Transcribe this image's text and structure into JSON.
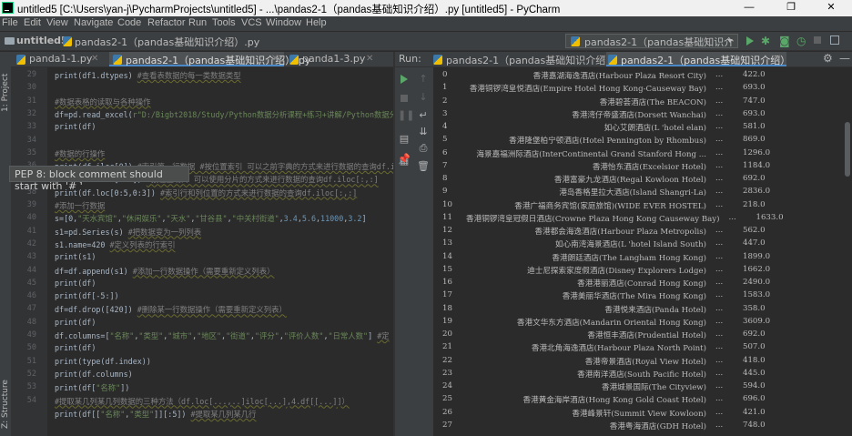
{
  "titlebar": {
    "title": "untitled5 [C:\\Users\\yan-j\\PycharmProjects\\untitled5] - ...\\pandas2-1（pandas基础知识介绍）.py [untitled5] - PyCharm",
    "minimize": "—",
    "maximize": "❐",
    "close": "✕"
  },
  "menu": [
    "File",
    "Edit",
    "View",
    "Navigate",
    "Code",
    "Refactor",
    "Run",
    "Tools",
    "VCS",
    "Window",
    "Help"
  ],
  "navbar": {
    "project": "untitled5",
    "file": "pandas2-1（pandas基础知识介绍）.py",
    "run_config": "pandas2-1（pandas基础知识介绍）"
  },
  "left_stripe": {
    "project": "1: Project",
    "structure": "Z: Structure"
  },
  "editor_tabs": [
    {
      "label": "panda1-1.py"
    },
    {
      "label": "pandas2-1（pandas基础知识介绍）.py"
    },
    {
      "label": "panda1-3.py"
    }
  ],
  "code": {
    "line_numbers": [
      "29",
      "30",
      "31",
      "32",
      "33",
      "34",
      "35",
      "36",
      "37",
      "38",
      "39",
      "40",
      "41",
      "42",
      "43",
      "44",
      "45",
      "46",
      "47",
      "48",
      "49",
      "50",
      "51",
      "52",
      "53",
      "54"
    ],
    "lines": [
      [
        {
          "t": "print(df1.dtypes)   "
        },
        {
          "t": "#查看表数据的每一类数据类型",
          "c": "cm"
        }
      ],
      [],
      [
        {
          "t": "#数据表格的读取与各种操作",
          "c": "cm"
        }
      ],
      [
        {
          "t": "df=pd.read_excel("
        },
        {
          "t": "r\"D:/Bigbt2018/Study/Python数据分析课程+练习+讲解/Python数据分析",
          "c": "str"
        }
      ],
      [
        {
          "t": "print(df)"
        }
      ],
      [],
      [
        {
          "t": "#数据的行操作",
          "c": "cm"
        }
      ],
      [
        {
          "t": "print(df.iloc[0]) "
        },
        {
          "t": "#索引第一行数据 #按位置索引 可以之前字典的方式来进行数据的查询df.iloc[:,:]",
          "c": "cm"
        }
      ],
      [
        {
          "t": "print(df.iloc[0:5])  "
        },
        {
          "t": "#按位置切片 可以使用分片的方式来进行数据的查询df.iloc[:,:]",
          "c": "cm"
        }
      ],
      [
        {
          "t": "print(df.loc[0:5,0:3]) "
        },
        {
          "t": "#索引行和列位置的方式来进行数据的查询df.iloc[:,:]",
          "c": "cm"
        }
      ],
      [
        {
          "t": "#添加一行数据",
          "c": "cm"
        }
      ],
      [
        {
          "t": "s=[0,"
        },
        {
          "t": "\"天水宾馆\"",
          "c": "str"
        },
        {
          "t": ","
        },
        {
          "t": "\"休闲娱乐\"",
          "c": "str"
        },
        {
          "t": ","
        },
        {
          "t": "\"天水\"",
          "c": "str"
        },
        {
          "t": ","
        },
        {
          "t": "\"甘谷县\"",
          "c": "str"
        },
        {
          "t": ","
        },
        {
          "t": "\"中关村街道\"",
          "c": "str"
        },
        {
          "t": ","
        },
        {
          "t": "3.4",
          "c": "num"
        },
        {
          "t": ","
        },
        {
          "t": "5.6",
          "c": "num"
        },
        {
          "t": ","
        },
        {
          "t": "11000",
          "c": "num"
        },
        {
          "t": ","
        },
        {
          "t": "3.2",
          "c": "num"
        },
        {
          "t": "]"
        }
      ],
      [
        {
          "t": "s1=pd.Series(s)       "
        },
        {
          "t": "#把数据变为一列列表",
          "c": "cm"
        }
      ],
      [
        {
          "t": "s1.name=420           "
        },
        {
          "t": "#定义列表的行索引",
          "c": "cm"
        }
      ],
      [
        {
          "t": "print(s1)"
        }
      ],
      [
        {
          "t": "df=df.append(s1)       "
        },
        {
          "t": "#添加一行数据操作（需要重新定义列表）",
          "c": "cm"
        }
      ],
      [
        {
          "t": "print(df)"
        }
      ],
      [
        {
          "t": "print(df[-5:])"
        }
      ],
      [
        {
          "t": "df=df.drop([420])       "
        },
        {
          "t": "#删除某一行数据操作（需要重新定义列表）",
          "c": "cm"
        }
      ],
      [
        {
          "t": "print(df)"
        }
      ],
      [
        {
          "t": "df.columns=["
        },
        {
          "t": "\"名称\"",
          "c": "str"
        },
        {
          "t": ","
        },
        {
          "t": "\"类型\"",
          "c": "str"
        },
        {
          "t": ","
        },
        {
          "t": "\"城市\"",
          "c": "str"
        },
        {
          "t": ","
        },
        {
          "t": "\"地区\"",
          "c": "str"
        },
        {
          "t": ","
        },
        {
          "t": "\"街道\"",
          "c": "str"
        },
        {
          "t": ","
        },
        {
          "t": "\"评分\"",
          "c": "str"
        },
        {
          "t": ","
        },
        {
          "t": "\"评价人数\"",
          "c": "str"
        },
        {
          "t": ","
        },
        {
          "t": "\"日常人数\"",
          "c": "str"
        },
        {
          "t": "]  "
        },
        {
          "t": "#定",
          "c": "cm"
        }
      ],
      [
        {
          "t": "print(df)"
        }
      ],
      [
        {
          "t": "print(type(df.index))"
        }
      ],
      [
        {
          "t": "print(df.columns)"
        }
      ],
      [
        {
          "t": "print(df["
        },
        {
          "t": "\"名称\"",
          "c": "str"
        },
        {
          "t": "])"
        }
      ],
      [
        {
          "t": "#提取某几列某几列数据的三种方法（df.loc[...,..]iloc[...],4.df[[...]]）",
          "c": "cm"
        }
      ],
      [
        {
          "t": "print(df[["
        },
        {
          "t": "\"名称\"",
          "c": "str"
        },
        {
          "t": ","
        },
        {
          "t": "\"类型\"",
          "c": "str"
        },
        {
          "t": "]][:5])  "
        },
        {
          "t": "#提取某几列某几行",
          "c": "cm"
        }
      ]
    ]
  },
  "tooltip": "PEP 8: block comment should start with '# '",
  "run": {
    "label": "Run:",
    "tabs": [
      {
        "label": "pandas2-1（pandas基础知识介绍）"
      },
      {
        "label": "pandas2-1（pandas基础知识介绍）"
      }
    ]
  },
  "console": [
    {
      "i": "0",
      "name": "香港嘉湖海逸酒店(Harbour Plaza Resort City)",
      "val": "422.0"
    },
    {
      "i": "1",
      "name": "香港铜锣湾皇悦酒店(Empire Hotel Hong Kong-Causeway Bay)",
      "val": "693.0"
    },
    {
      "i": "2",
      "name": "香港碧荟酒店(The BEACON)",
      "val": "747.0"
    },
    {
      "i": "3",
      "name": "香港湾仔帝盛酒店(Dorsett Wanchai)",
      "val": "693.0"
    },
    {
      "i": "4",
      "name": "如心艾朗酒店(L 'hotel elan)",
      "val": "581.0"
    },
    {
      "i": "5",
      "name": "香港隆堡柏宁顿酒店(Hotel Pennington by Rhombus)",
      "val": "869.0"
    },
    {
      "i": "6",
      "name": "海景嘉福洲际酒店(InterContinental Grand Stanford Hong ...",
      "val": "1296.0"
    },
    {
      "i": "7",
      "name": "香港怡东酒店(Excelsior Hotel)",
      "val": "1184.0"
    },
    {
      "i": "8",
      "name": "香港富豪九龙酒店(Regal Kowloon Hotel)",
      "val": "692.0"
    },
    {
      "i": "9",
      "name": "港岛香格里拉大酒店(Island Shangri-La)",
      "val": "2836.0"
    },
    {
      "i": "10",
      "name": "香港广福商务宾馆(家庭旅馆)(WIDE EVER HOSTEL)",
      "val": "218.0"
    },
    {
      "i": "11",
      "name": "香港铜锣湾皇冠假日酒店(Crowne Plaza Hong Kong Causeway Bay)",
      "val": "1633.0"
    },
    {
      "i": "12",
      "name": "香港都会海逸酒店(Harbour Plaza Metropolis)",
      "val": "562.0"
    },
    {
      "i": "13",
      "name": "如心南湾海景酒店(L 'hotel Island South)",
      "val": "447.0"
    },
    {
      "i": "14",
      "name": "香港朗廷酒店(The Langham Hong Kong)",
      "val": "1899.0"
    },
    {
      "i": "15",
      "name": "迪士尼探索家度假酒店(Disney Explorers Lodge)",
      "val": "1662.0"
    },
    {
      "i": "16",
      "name": "香港港丽酒店(Conrad Hong Kong)",
      "val": "2490.0"
    },
    {
      "i": "17",
      "name": "香港美丽华酒店(The Mira Hong Kong)",
      "val": "1583.0"
    },
    {
      "i": "18",
      "name": "香港悦来酒店(Panda Hotel)",
      "val": "358.0"
    },
    {
      "i": "19",
      "name": "香港文华东方酒店(Mandarin Oriental Hong Kong)",
      "val": "3609.0"
    },
    {
      "i": "20",
      "name": "香港恒丰酒店(Prudential Hotel)",
      "val": "692.0"
    },
    {
      "i": "21",
      "name": "香港北角海逸酒店(Harbour Plaza North Point)",
      "val": "507.0"
    },
    {
      "i": "22",
      "name": "香港帝景酒店(Royal View Hotel)",
      "val": "418.0"
    },
    {
      "i": "23",
      "name": "香港南洋酒店(South Pacific Hotel)",
      "val": "445.0"
    },
    {
      "i": "24",
      "name": "香港城景国际(The Cityview)",
      "val": "594.0"
    },
    {
      "i": "25",
      "name": "香港黄金海岸酒店(Hong Kong Gold Coast Hotel)",
      "val": "696.0"
    },
    {
      "i": "26",
      "name": "香港峰景轩(Summit View Kowloon)",
      "val": "421.0"
    },
    {
      "i": "27",
      "name": "香港粤海酒店(GDH Hotel)",
      "val": "748.0"
    }
  ]
}
